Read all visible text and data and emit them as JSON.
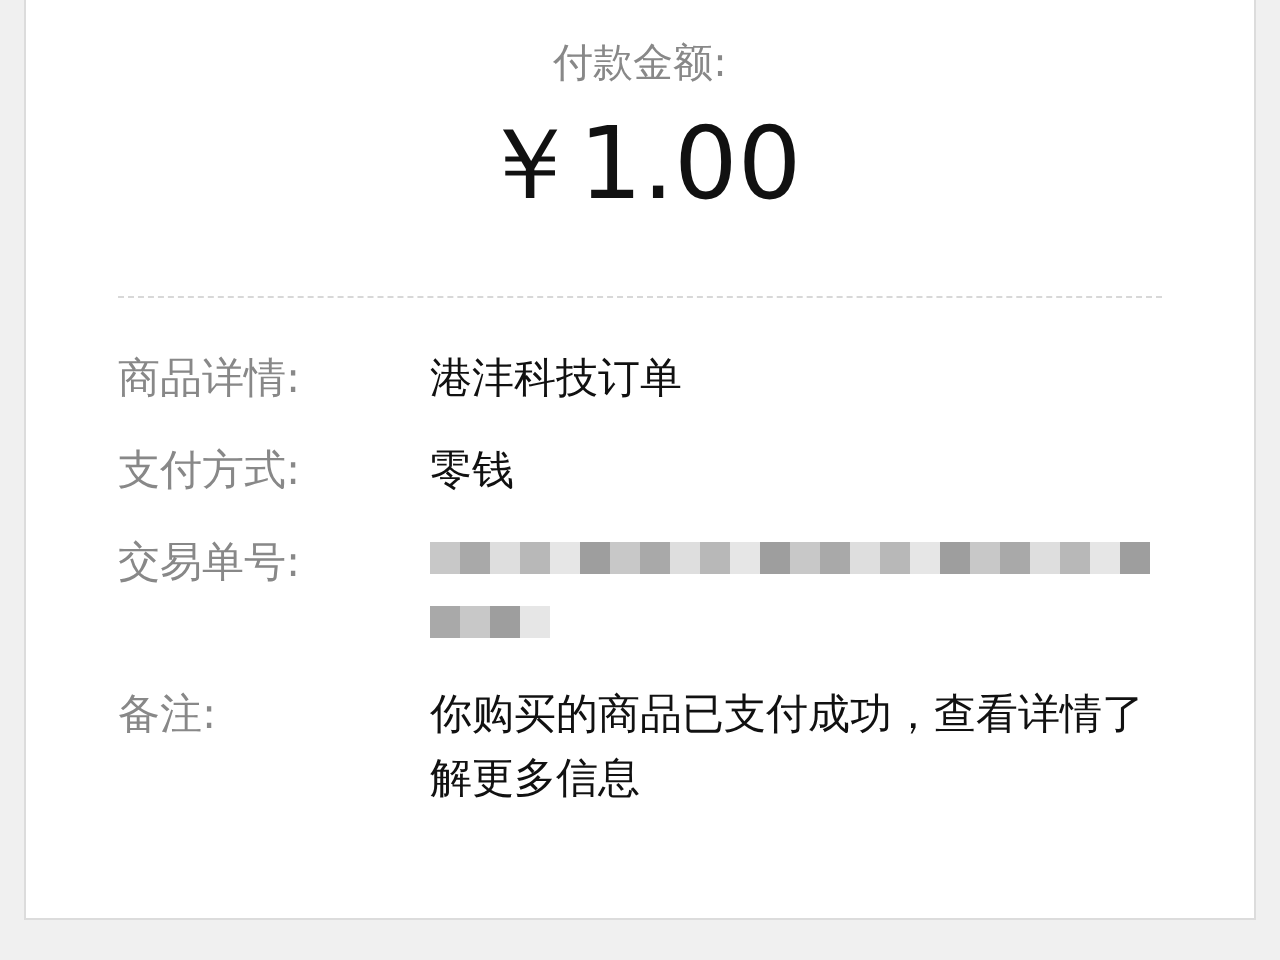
{
  "payment": {
    "title": "付款金额:",
    "amount": "￥1.00"
  },
  "details": [
    {
      "kind": "text",
      "label": "商品详情:",
      "value": "港沣科技订单"
    },
    {
      "kind": "text",
      "label": "支付方式:",
      "value": "零钱"
    },
    {
      "kind": "redacted",
      "label": "交易单号:"
    },
    {
      "kind": "text",
      "label": "备注:",
      "value": "你购买的商品已支付成功，查看详情了解更多信息"
    }
  ]
}
